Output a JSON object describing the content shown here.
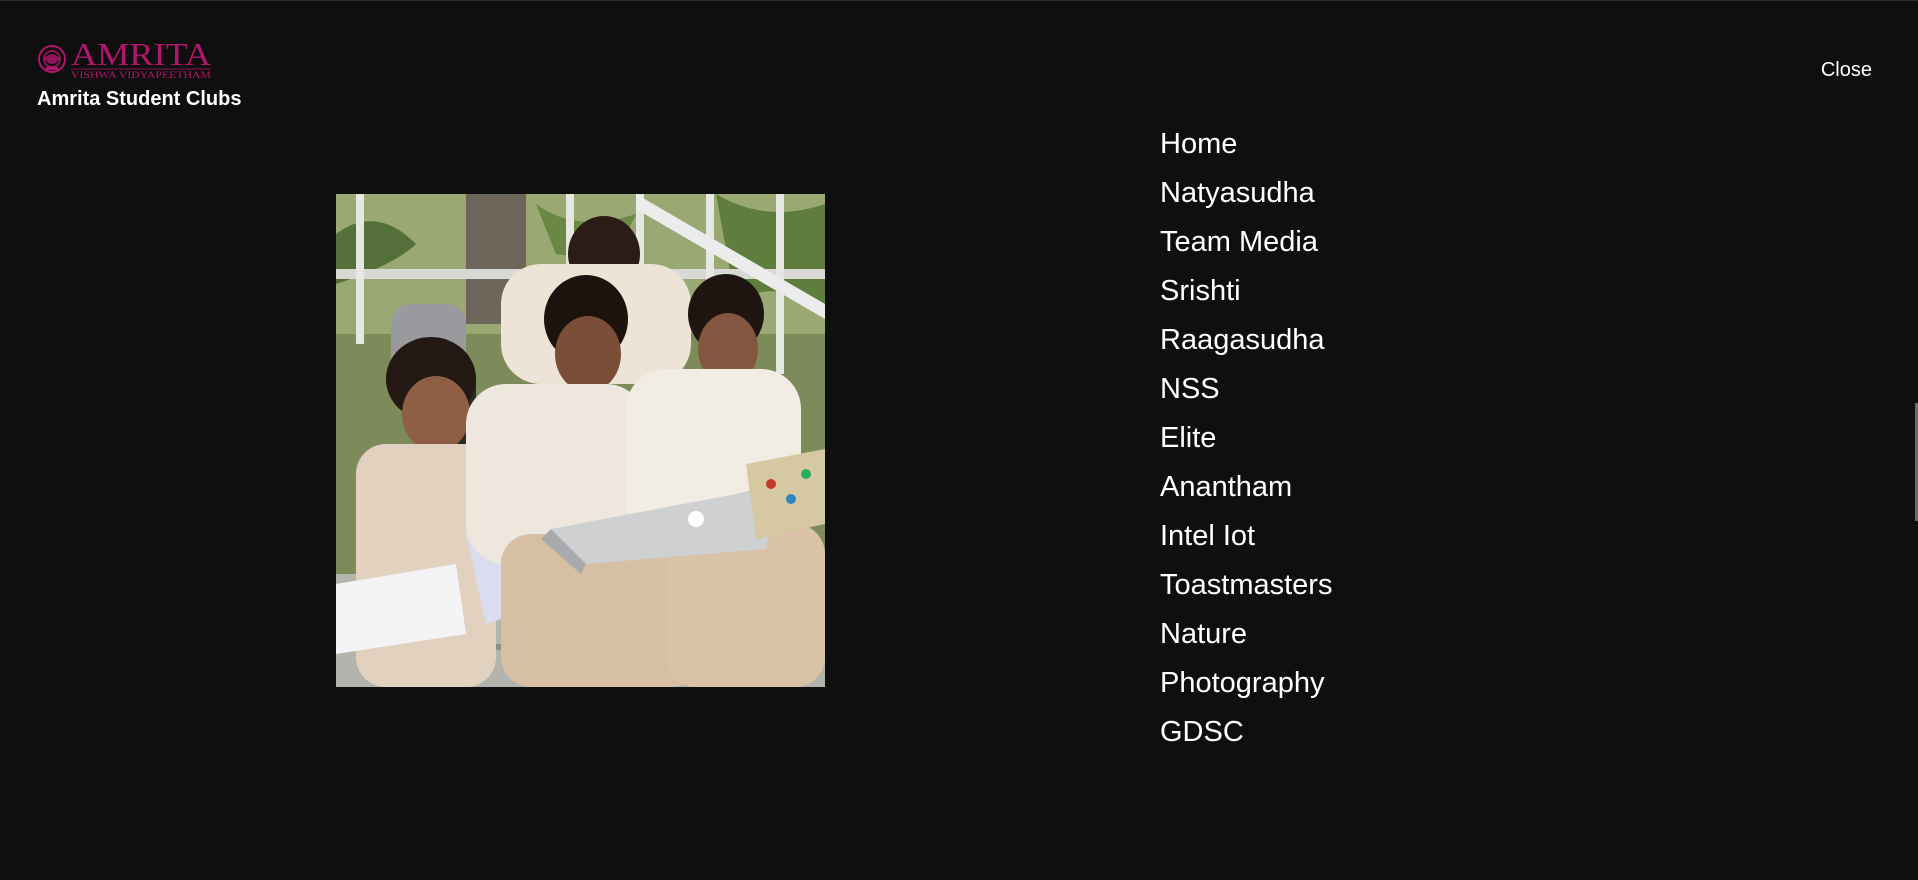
{
  "header": {
    "logo": {
      "wordmark": "AMRITA",
      "tagline": "VISHWA VIDYAPEETHAM",
      "color": "#b2156c"
    },
    "site_title": "Amrita Student Clubs",
    "close_label": "Close"
  },
  "nav": {
    "items": [
      {
        "label": "Home"
      },
      {
        "label": "Natyasudha"
      },
      {
        "label": "Team Media"
      },
      {
        "label": "Srishti"
      },
      {
        "label": "Raagasudha"
      },
      {
        "label": "NSS"
      },
      {
        "label": "Elite"
      },
      {
        "label": "Anantham"
      },
      {
        "label": "Intel Iot"
      },
      {
        "label": "Toastmasters"
      },
      {
        "label": "Nature"
      },
      {
        "label": "Photography"
      },
      {
        "label": "GDSC"
      }
    ]
  },
  "colors": {
    "background": "#0f0f0f",
    "text": "#ffffff",
    "brand": "#b2156c"
  }
}
